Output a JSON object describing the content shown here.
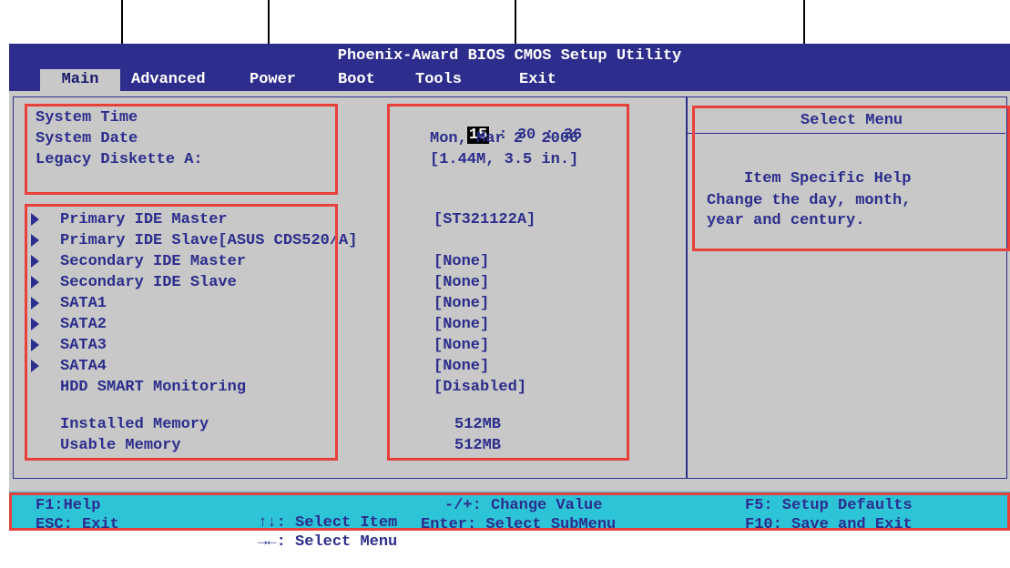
{
  "title": "Phoenix-Award BIOS CMOS Setup Utility",
  "menu": [
    "Main",
    "Advanced",
    "Power",
    "Boot",
    "Tools",
    "Exit"
  ],
  "active_menu": "Main",
  "main": {
    "system_time": {
      "label": "System Time",
      "hour": "15",
      "rest": " : 30 : 36"
    },
    "system_date": {
      "label": "System Date",
      "value": "Mon, Mar 2  2006"
    },
    "legacy_diskette": {
      "label": "Legacy Diskette A:",
      "value": "[1.44M, 3.5 in.]"
    },
    "ide_items": [
      {
        "label": "Primary IDE Master",
        "value": "[ST321122A]",
        "submenu": true
      },
      {
        "label": "Primary IDE Slave[ASUS CDS520/A]",
        "value": "",
        "submenu": true
      },
      {
        "label": "Secondary IDE Master",
        "value": "[None]",
        "submenu": true
      },
      {
        "label": "Secondary IDE Slave",
        "value": "[None]",
        "submenu": true
      },
      {
        "label": "SATA1",
        "value": "[None]",
        "submenu": true
      },
      {
        "label": "SATA2",
        "value": "[None]",
        "submenu": true
      },
      {
        "label": "SATA3",
        "value": "[None]",
        "submenu": true
      },
      {
        "label": "SATA4",
        "value": "[None]",
        "submenu": true
      },
      {
        "label": "HDD SMART Monitoring",
        "value": "[Disabled]",
        "submenu": false
      }
    ],
    "installed_memory": {
      "label": "Installed Memory",
      "value": "512MB"
    },
    "usable_memory": {
      "label": "Usable Memory",
      "value": "512MB"
    }
  },
  "help": {
    "title": "Select Menu",
    "subtitle": "Item Specific Help",
    "lines": [
      "Change the day, month,",
      "year and century."
    ]
  },
  "footer": {
    "f1": "F1:Help",
    "esc": "ESC: Exit",
    "nav1_arrows": "↑↓",
    "nav1_text": ": Select Item",
    "nav2_arrows": "→←",
    "nav2_text": ": Select Menu",
    "change": "-/+: Change Value",
    "enter": "Enter: Select SubMenu",
    "f5": "F5: Setup Defaults",
    "f10": "F10: Save and Exit"
  },
  "colors": {
    "bios_blue": "#2c2d8c",
    "panel_gray": "#c8c8c8",
    "footer_cyan": "#2ec4d8",
    "highlight_red": "#e8403a"
  }
}
